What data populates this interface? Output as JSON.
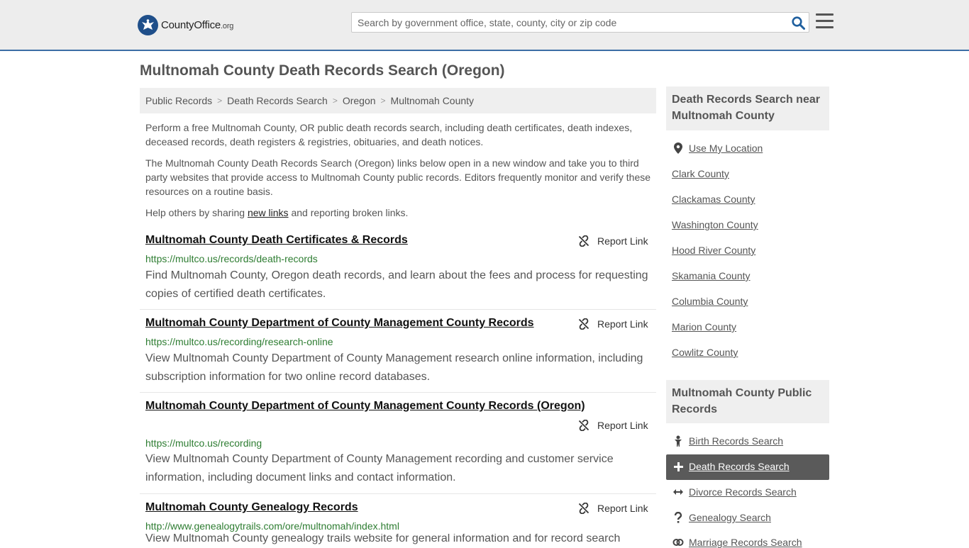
{
  "header": {
    "logo_main": "CountyOffice",
    "logo_suffix": ".org",
    "search_placeholder": "Search by government office, state, county, city or zip code"
  },
  "page_title": "Multnomah County Death Records Search (Oregon)",
  "breadcrumb": [
    "Public Records",
    "Death Records Search",
    "Oregon",
    "Multnomah County"
  ],
  "intro": {
    "p1": "Perform a free Multnomah County, OR public death records search, including death certificates, death indexes, deceased records, death registers & registries, obituaries, and death notices.",
    "p2": "The Multnomah County Death Records Search (Oregon) links below open in a new window and take you to third party websites that provide access to Multnomah County public records. Editors frequently monitor and verify these resources on a routine basis.",
    "p3_before": "Help others by sharing ",
    "p3_link": "new links",
    "p3_after": " and reporting broken links."
  },
  "report_label": "Report Link",
  "results": [
    {
      "title": "Multnomah County Death Certificates & Records",
      "url": "https://multco.us/records/death-records",
      "desc": "Find Multnomah County, Oregon death records, and learn about the fees and process for requesting copies of certified death certificates."
    },
    {
      "title": "Multnomah County Department of County Management County Records",
      "url": "https://multco.us/recording/research-online",
      "desc": "View Multnomah County Department of County Management research online information, including subscription information for two online record databases."
    },
    {
      "title": "Multnomah County Department of County Management County Records (Oregon)",
      "url": "https://multco.us/recording",
      "desc": "View Multnomah County Department of County Management recording and customer service information, including document links and contact information."
    },
    {
      "title": "Multnomah County Genealogy Records",
      "url": "http://www.genealogytrails.com/ore/multnomah/index.html",
      "desc": "View Multnomah County genealogy trails website for general information and for record search"
    }
  ],
  "sidebar": {
    "nearby_heading": "Death Records Search near Multnomah County",
    "use_location": "Use My Location",
    "nearby": [
      "Clark County",
      "Clackamas County",
      "Washington County",
      "Hood River County",
      "Skamania County",
      "Columbia County",
      "Marion County",
      "Cowlitz County"
    ],
    "public_heading": "Multnomah County Public Records",
    "public_links": [
      {
        "label": "Birth Records Search",
        "icon": "baby-icon"
      },
      {
        "label": "Death Records Search",
        "icon": "cross-icon",
        "active": true
      },
      {
        "label": "Divorce Records Search",
        "icon": "split-arrows-icon"
      },
      {
        "label": "Genealogy Search",
        "icon": "question-icon"
      },
      {
        "label": "Marriage Records Search",
        "icon": "rings-icon"
      }
    ]
  },
  "colors": {
    "header_bg": "#ededed",
    "header_border": "#3c6ea5",
    "url_green": "#2e7d32",
    "active_bg": "#5a5a5a"
  }
}
